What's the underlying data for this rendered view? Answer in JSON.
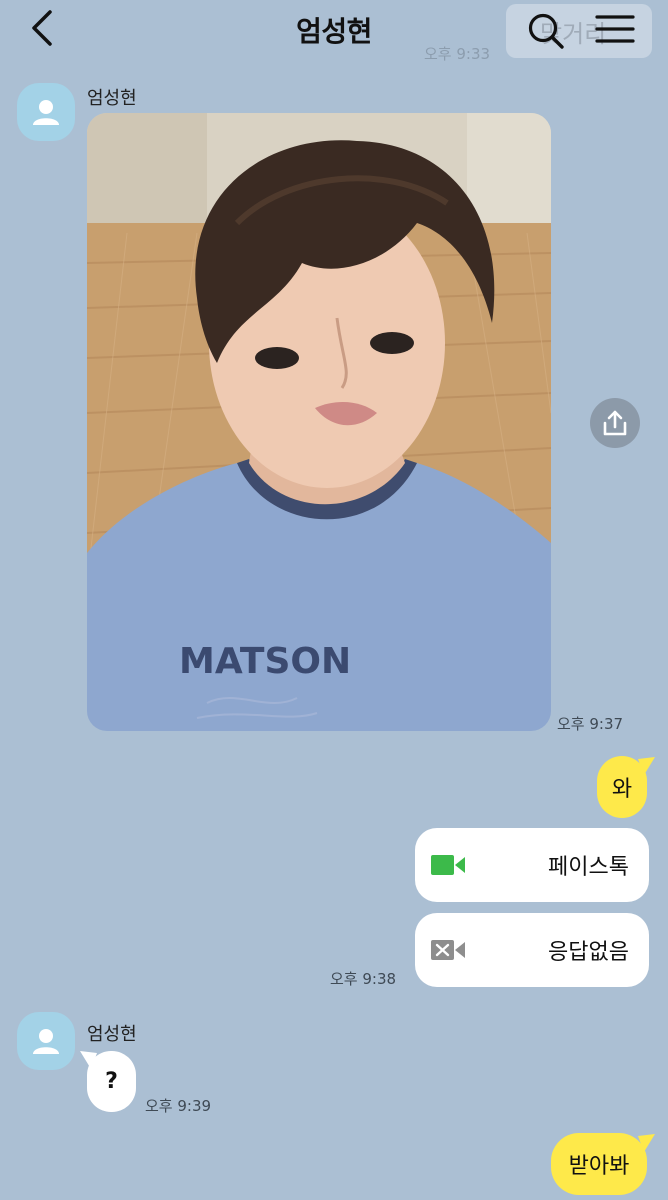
{
  "header": {
    "title": "엄성현",
    "back_icon": "chevron-left-icon",
    "search_icon": "search-icon",
    "menu_icon": "hamburger-menu-icon",
    "ghost_label": "맞거리",
    "ghost_time": "오후 9:33"
  },
  "colors": {
    "background": "#abbfd3",
    "my_bubble": "#fee94a",
    "their_bubble": "#ffffff",
    "avatar": "#a3d2e7",
    "facetime_green": "#3cba4a",
    "missed_gray": "#8e8e8e"
  },
  "messages": [
    {
      "sender": "엄성현",
      "type": "photo",
      "photo_text": "MATSON",
      "time": "오후 9:37"
    },
    {
      "sender": "me",
      "type": "text",
      "text": "와"
    },
    {
      "sender": "me",
      "type": "call",
      "icon": "facetime-video-icon",
      "text": "페이스톡"
    },
    {
      "sender": "me",
      "type": "call",
      "icon": "missed-video-icon",
      "text": "응답없음",
      "time": "오후 9:38"
    },
    {
      "sender": "엄성현",
      "type": "text",
      "text": "?",
      "time": "오후 9:39"
    },
    {
      "sender": "me",
      "type": "text",
      "text": "받아봐"
    }
  ]
}
